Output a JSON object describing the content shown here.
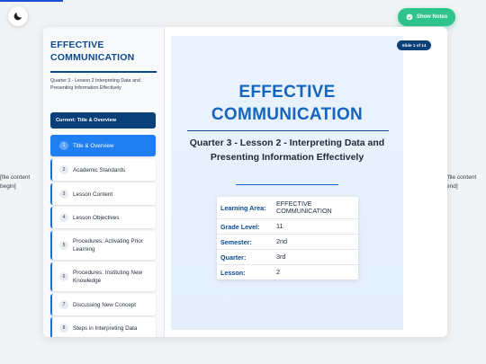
{
  "file_markers": {
    "begin": "[file content begin]",
    "end": "[file content end]"
  },
  "controls": {
    "theme_icon": "moon-icon",
    "notes_label": "Show Notes",
    "notes_icon": "check-circle-icon"
  },
  "sidebar": {
    "title": "EFFECTIVE COMMUNICATION",
    "subtitle": "Quarter 3 - Lesson 2 Interpreting Data and Presenting Information Effectively",
    "current": "Current: Title & Overview",
    "items": [
      {
        "num": "1",
        "label": "Title & Overview"
      },
      {
        "num": "2",
        "label": "Academic Standards"
      },
      {
        "num": "3",
        "label": "Lesson Content"
      },
      {
        "num": "4",
        "label": "Lesson Objectives"
      },
      {
        "num": "5",
        "label": "Procedures: Activating Prior Learning"
      },
      {
        "num": "6",
        "label": "Procedures: Instituting New Knowledge"
      },
      {
        "num": "7",
        "label": "Discussing New Concept"
      },
      {
        "num": "8",
        "label": "Steps in Interpreting Data"
      }
    ]
  },
  "slide": {
    "badge": "Slide 1 of 14",
    "title": "EFFECTIVE COMMUNICATION",
    "subtitle": "Quarter 3 - Lesson 2 - Interpreting Data and Presenting Information Effectively",
    "info": [
      {
        "key": "Learning Area:",
        "value": "EFFECTIVE COMMUNICATION"
      },
      {
        "key": "Grade Level:",
        "value": "11"
      },
      {
        "key": "Semester:",
        "value": "2nd"
      },
      {
        "key": "Quarter:",
        "value": "3rd"
      },
      {
        "key": "Lesson:",
        "value": "2"
      }
    ]
  },
  "colors": {
    "accent": "#1f7ff0",
    "brand": "#0b4a8f",
    "notes": "#2fc48d"
  }
}
